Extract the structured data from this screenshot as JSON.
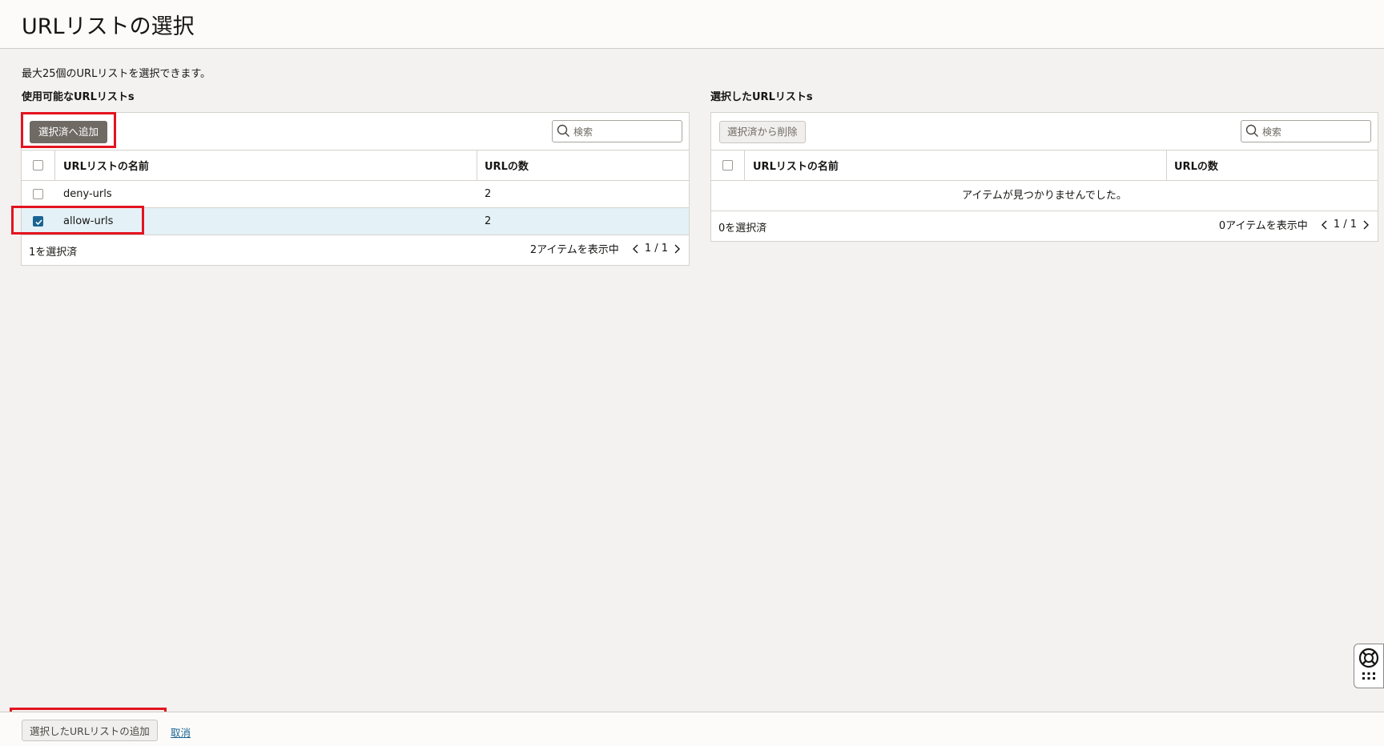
{
  "page": {
    "title": "URLリストの選択",
    "description": "最大25個のURLリストを選択できます。"
  },
  "available": {
    "title": "使用可能なURLリストs",
    "add_button": "選択済へ追加",
    "search_placeholder": "検索",
    "columns": [
      "URLリストの名前",
      "URLの数"
    ],
    "rows": [
      {
        "name": "deny-urls",
        "count": "2",
        "checked": false
      },
      {
        "name": "allow-urls",
        "count": "2",
        "checked": true
      }
    ],
    "selected_count": "1を選択済",
    "showing": "2アイテムを表示中",
    "page": "1 / 1"
  },
  "selected": {
    "title": "選択したURLリストs",
    "remove_button": "選択済から削除",
    "search_placeholder": "検索",
    "columns": [
      "URLリストの名前",
      "URLの数"
    ],
    "empty_message": "アイテムが見つかりませんでした。",
    "selected_count": "0を選択済",
    "showing": "0アイテムを表示中",
    "page": "1 / 1"
  },
  "footer": {
    "add_button": "選択したURLリストの追加",
    "cancel_link": "取消"
  },
  "colors": {
    "highlight_box": "#e3141f",
    "selected_row": "#e4f1f7",
    "checkbox_checked": "#1a6492"
  }
}
